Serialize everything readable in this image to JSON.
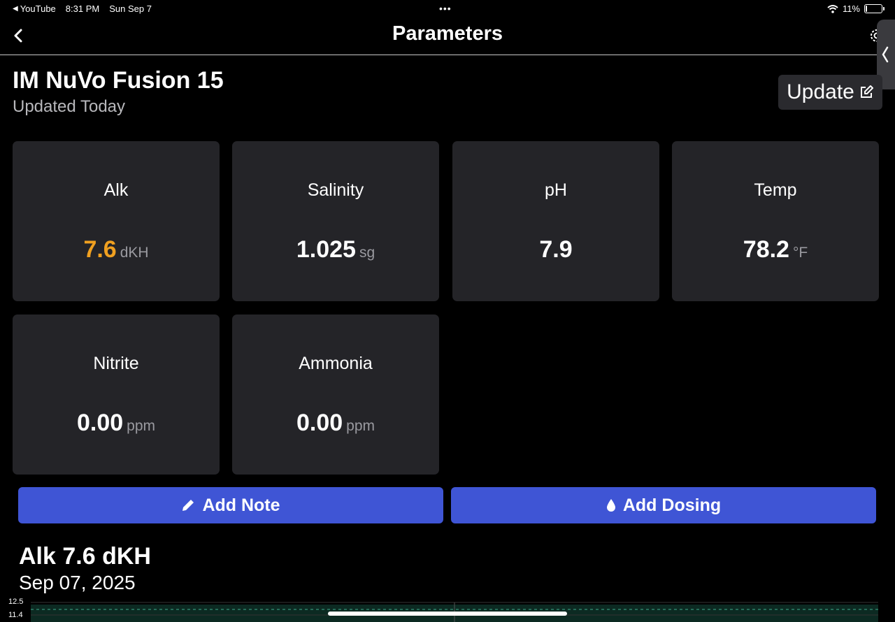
{
  "status_bar": {
    "back_app": "YouTube",
    "time": "8:31 PM",
    "date": "Sun Sep 7",
    "battery": "11%",
    "battery_level": 0.11
  },
  "nav": {
    "title": "Parameters",
    "back_icon": "chevron-left-icon",
    "settings_icon": "gear-icon"
  },
  "tank": {
    "name": "IM NuVo Fusion 15",
    "updated": "Updated Today",
    "update_label": "Update",
    "update_icon": "edit-icon"
  },
  "params": [
    {
      "label": "Alk",
      "value": "7.6",
      "unit": "dKH",
      "color": "#f0a020"
    },
    {
      "label": "Salinity",
      "value": "1.025",
      "unit": "sg",
      "color": "#ffffff"
    },
    {
      "label": "pH",
      "value": "7.9",
      "unit": "",
      "color": "#ffffff"
    },
    {
      "label": "Temp",
      "value": "78.2",
      "unit": "°F",
      "color": "#ffffff"
    },
    {
      "label": "Nitrite",
      "value": "0.00",
      "unit": "ppm",
      "color": "#ffffff"
    },
    {
      "label": "Ammonia",
      "value": "0.00",
      "unit": "ppm",
      "color": "#ffffff"
    }
  ],
  "actions": {
    "add_note": "Add Note",
    "add_dosing": "Add Dosing"
  },
  "detail": {
    "title": "Alk 7.6 dKH",
    "date": "Sep 07, 2025"
  },
  "chart_data": {
    "type": "line",
    "y_ticks": [
      "12.5",
      "11.4"
    ],
    "series": []
  },
  "colors": {
    "accent": "#3f55d5",
    "alk_highlight": "#f0a020",
    "card_bg": "#242428"
  }
}
